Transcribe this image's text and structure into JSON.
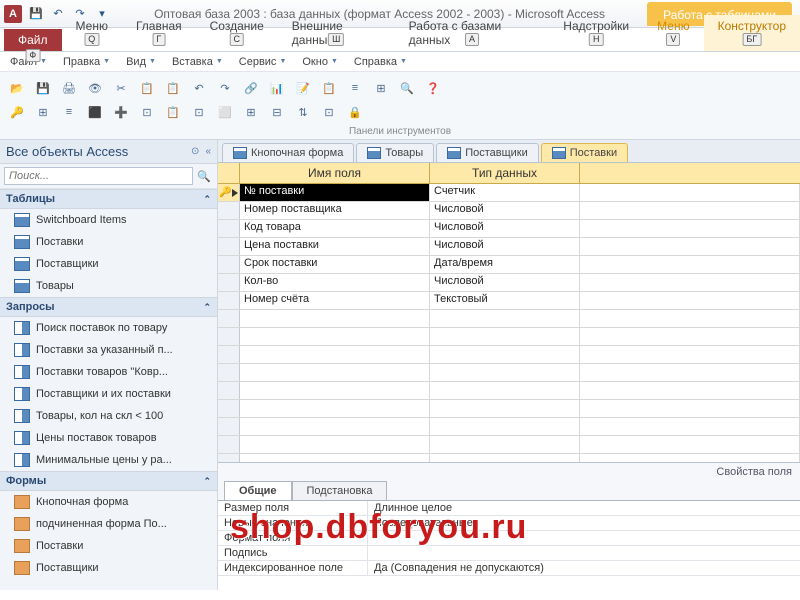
{
  "title": "Оптовая база 2003 : база данных (формат Access 2002 - 2003) - Microsoft Access",
  "contextTab": "Работа с таблицами",
  "ribbon": {
    "file": "Файл",
    "tabs": [
      {
        "label": "Меню",
        "key": "Q"
      },
      {
        "label": "Главная",
        "key": "Г"
      },
      {
        "label": "Создание",
        "key": "С"
      },
      {
        "label": "Внешние данные",
        "key": "Ш"
      },
      {
        "label": "Работа с базами данных",
        "key": "А"
      },
      {
        "label": "Надстройки",
        "key": "Н"
      },
      {
        "label": "Меню",
        "key": "V"
      },
      {
        "label": "Конструктор",
        "key": "БГ"
      }
    ],
    "fileKey": "Ф"
  },
  "subtabs": [
    "Файл",
    "Правка",
    "Вид",
    "Вставка",
    "Сервис",
    "Окно",
    "Справка"
  ],
  "toolbarCaption": "Панели инструментов",
  "nav": {
    "header": "Все объекты Access",
    "searchPlaceholder": "Поиск...",
    "groups": [
      {
        "title": "Таблицы",
        "type": "table",
        "items": [
          "Switchboard Items",
          "Поставки",
          "Поставщики",
          "Товары"
        ]
      },
      {
        "title": "Запросы",
        "type": "query",
        "items": [
          "Поиск поставок по товару",
          "Поставки за указанный п...",
          "Поставки товаров \"Ковр...",
          "Поставщики и их поставки",
          "Товары, кол на скл < 100",
          "Цены поставок товаров",
          "Минимальные цены у ра..."
        ]
      },
      {
        "title": "Формы",
        "type": "form",
        "items": [
          "Кнопочная форма",
          "подчиненная форма По...",
          "Поставки",
          "Поставщики"
        ]
      }
    ]
  },
  "docTabs": [
    "Кнопочная форма",
    "Товары",
    "Поставщики",
    "Поставки"
  ],
  "activeDocTab": 3,
  "gridHeaders": {
    "col1": "Имя поля",
    "col2": "Тип данных"
  },
  "fields": [
    {
      "name": "№ поставки",
      "type": "Счетчик",
      "pk": true
    },
    {
      "name": "Номер поставщика",
      "type": "Числовой"
    },
    {
      "name": "Код товара",
      "type": "Числовой"
    },
    {
      "name": "Цена поставки",
      "type": "Числовой"
    },
    {
      "name": "Срок поставки",
      "type": "Дата/время"
    },
    {
      "name": "Кол-во",
      "type": "Числовой"
    },
    {
      "name": "Номер счёта",
      "type": "Текстовый"
    }
  ],
  "propSheet": {
    "title": "Свойства поля",
    "tabs": [
      "Общие",
      "Подстановка"
    ],
    "rows": [
      {
        "label": "Размер поля",
        "value": "Длинное целое"
      },
      {
        "label": "Новые значения",
        "value": "Последовательные"
      },
      {
        "label": "Формат поля",
        "value": ""
      },
      {
        "label": "Подпись",
        "value": ""
      },
      {
        "label": "Индексированное поле",
        "value": "Да (Совпадения не допускаются)"
      }
    ]
  },
  "watermark": "shop.dbforyou.ru"
}
